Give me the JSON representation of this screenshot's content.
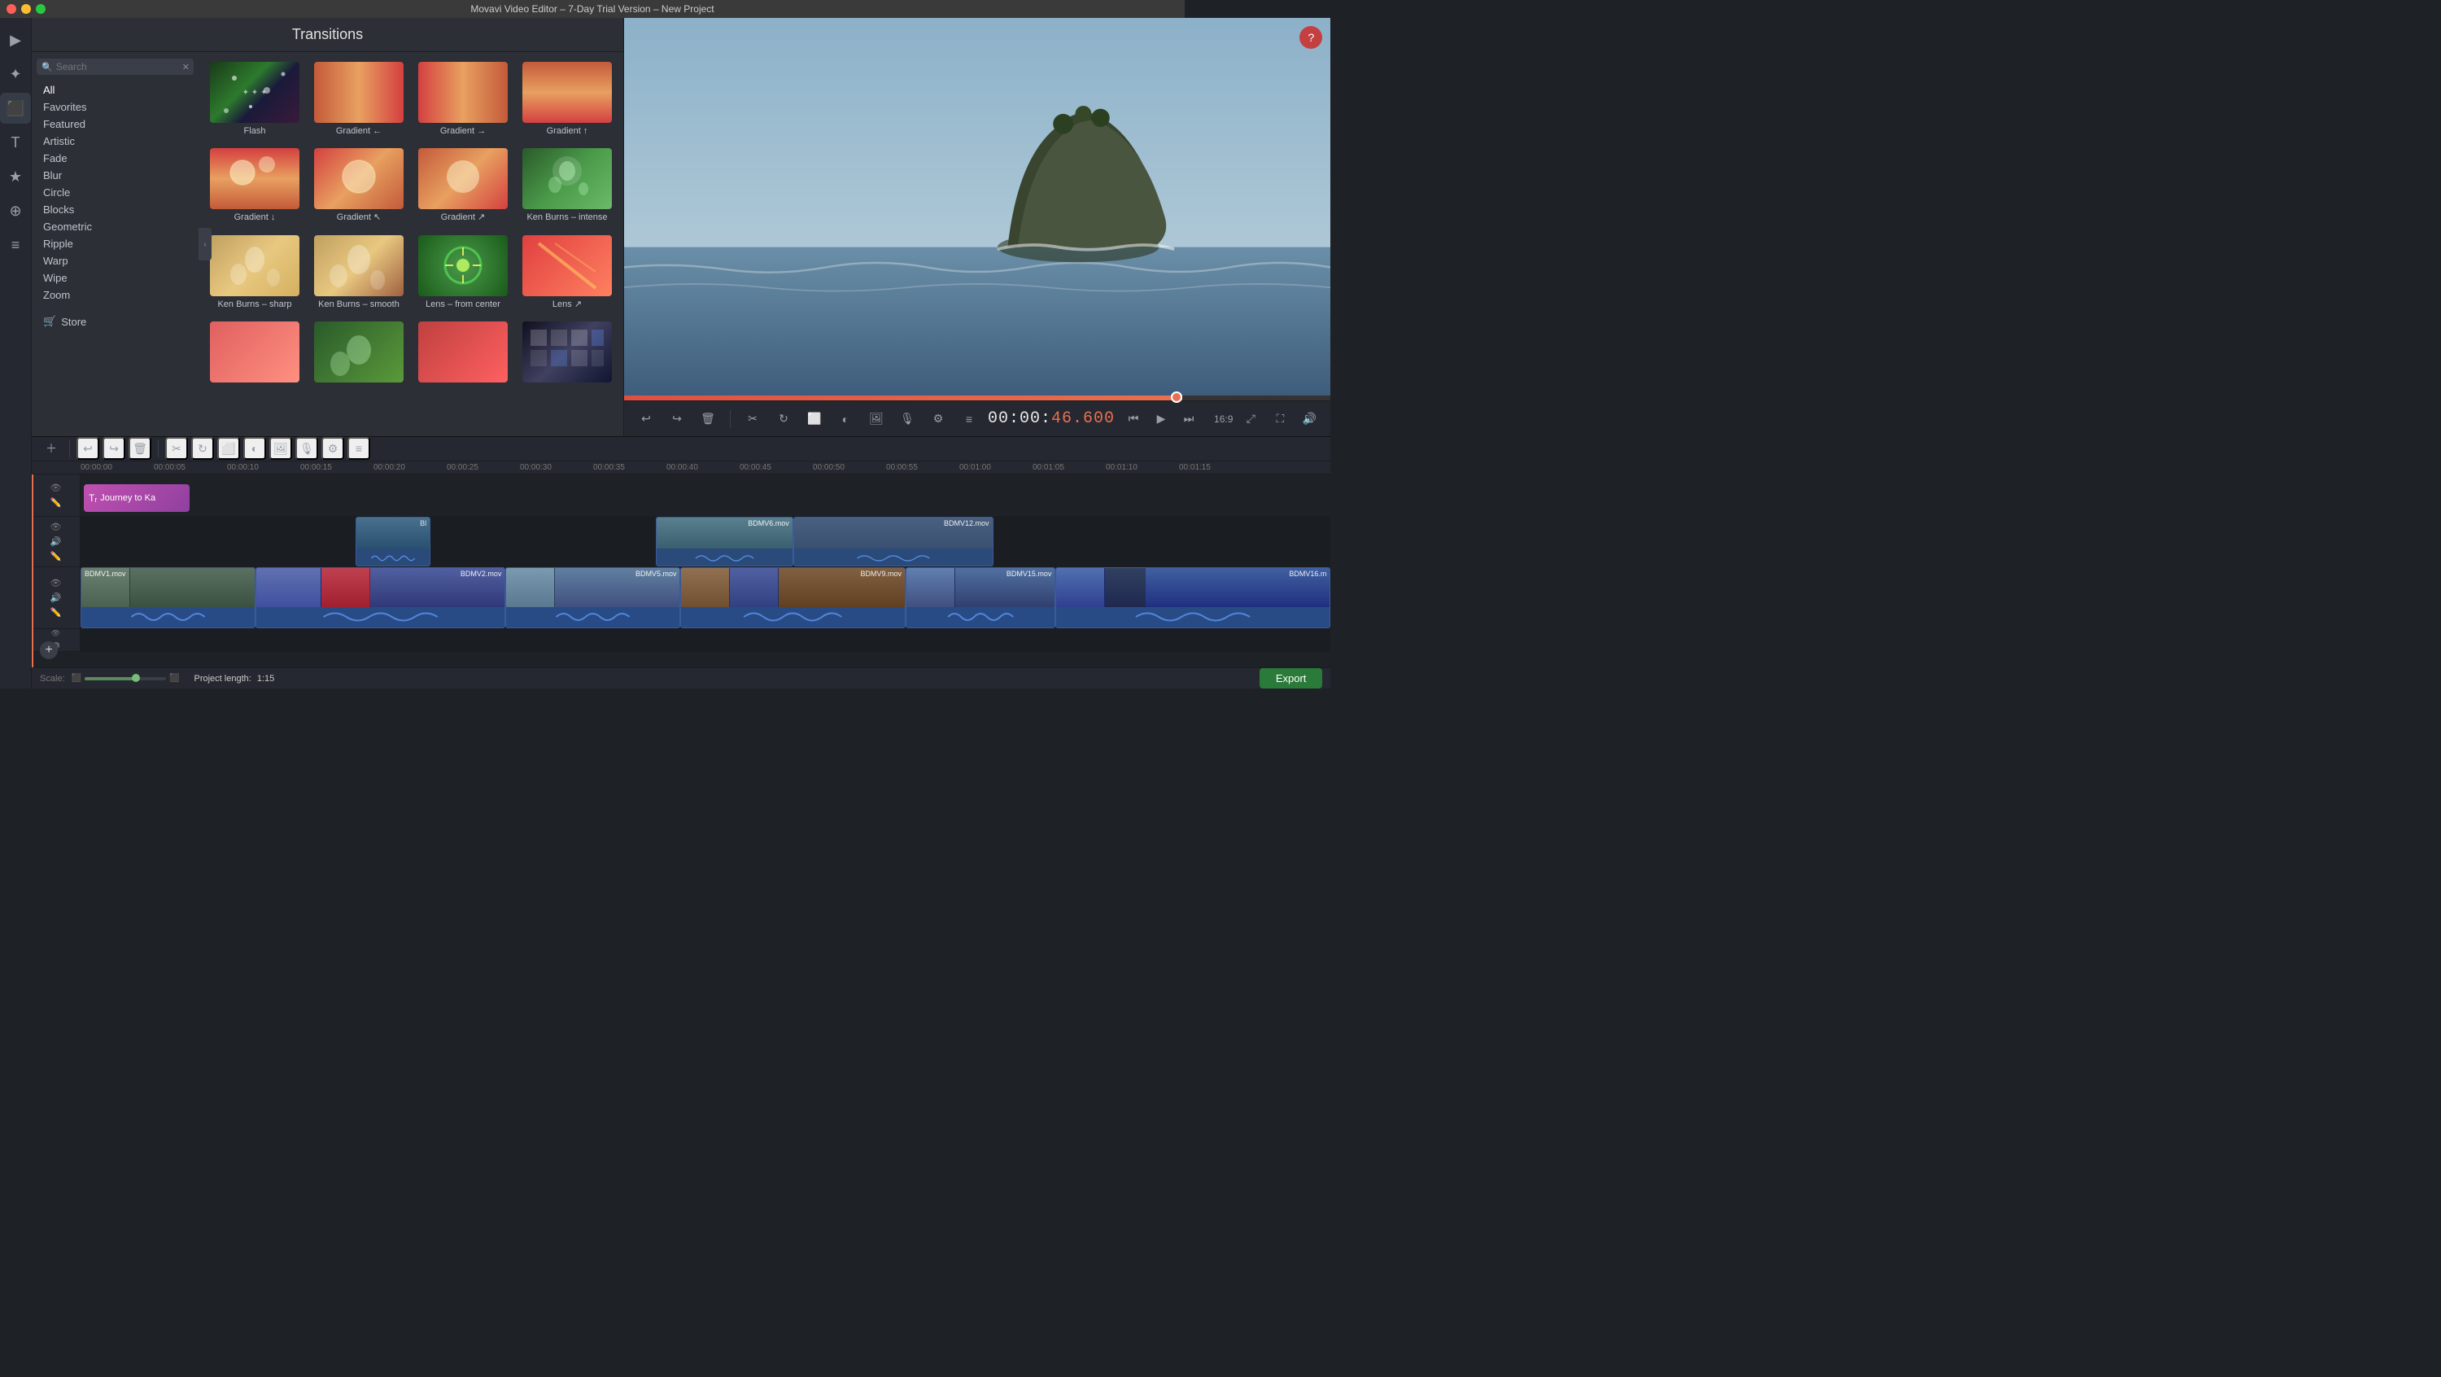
{
  "window": {
    "title": "Movavi Video Editor – 7-Day Trial Version – New Project"
  },
  "sidebar": {
    "icons": [
      {
        "name": "media-icon",
        "symbol": "▶",
        "active": false
      },
      {
        "name": "effects-icon",
        "symbol": "✦",
        "active": false
      },
      {
        "name": "clips-icon",
        "symbol": "⬛",
        "active": true
      },
      {
        "name": "text-icon",
        "symbol": "T",
        "active": false
      },
      {
        "name": "transitions-icon",
        "symbol": "★",
        "active": false
      },
      {
        "name": "filters-icon",
        "symbol": "⊕",
        "active": false
      },
      {
        "name": "audio-icon",
        "symbol": "≡",
        "active": false
      }
    ]
  },
  "transitions": {
    "title": "Transitions",
    "search_placeholder": "Search",
    "categories": [
      {
        "label": "All",
        "active": true
      },
      {
        "label": "Favorites",
        "active": false
      },
      {
        "label": "Featured",
        "active": false
      },
      {
        "label": "Artistic",
        "active": false
      },
      {
        "label": "Fade",
        "active": false
      },
      {
        "label": "Blur",
        "active": false
      },
      {
        "label": "Circle",
        "active": false
      },
      {
        "label": "Blocks",
        "active": false
      },
      {
        "label": "Geometric",
        "active": false
      },
      {
        "label": "Ripple",
        "active": false
      },
      {
        "label": "Warp",
        "active": false
      },
      {
        "label": "Wipe",
        "active": false
      },
      {
        "label": "Zoom",
        "active": false
      }
    ],
    "store_label": "Store",
    "items": [
      {
        "name": "Flash",
        "thumb": "flash"
      },
      {
        "name": "Gradient ←",
        "thumb": "gradient-l"
      },
      {
        "name": "Gradient →",
        "thumb": "gradient-r"
      },
      {
        "name": "Gradient ↑",
        "thumb": "gradient-u"
      },
      {
        "name": "Gradient ↓",
        "thumb": "gradient-d"
      },
      {
        "name": "Gradient ↖",
        "thumb": "gradient-br"
      },
      {
        "name": "Gradient ↗",
        "thumb": "gradient-tl"
      },
      {
        "name": "Ken Burns – intense",
        "thumb": "kburns-i"
      },
      {
        "name": "Ken Burns – sharp",
        "thumb": "kburns-sharp"
      },
      {
        "name": "Ken Burns – smooth",
        "thumb": "kburns-smooth"
      },
      {
        "name": "Lens – from center",
        "thumb": "lens-center"
      },
      {
        "name": "Lens ↗",
        "thumb": "lens-diag"
      },
      {
        "name": "",
        "thumb": "unknown1"
      },
      {
        "name": "",
        "thumb": "unknown2"
      },
      {
        "name": "",
        "thumb": "unknown3"
      },
      {
        "name": "",
        "thumb": "unknown4"
      }
    ]
  },
  "preview": {
    "question_label": "?",
    "timecode": "00:00:",
    "timecode_highlight": "46.600",
    "aspect_ratio": "16:9"
  },
  "toolbar": {
    "undo_label": "↩",
    "redo_label": "↪",
    "delete_label": "🗑",
    "cut_label": "✂",
    "rotate_label": "↻",
    "crop_label": "⬜",
    "color_label": "◐",
    "image_label": "🖼",
    "audio_label": "🎙",
    "settings_label": "⚙",
    "levels_label": "≡"
  },
  "timeline": {
    "time_markers": [
      "00:00:00",
      "00:00:05",
      "00:00:10",
      "00:00:15",
      "00:00:20",
      "00:00:25",
      "00:00:30",
      "00:00:35",
      "00:00:40",
      "00:00:45",
      "00:00:50",
      "00:00:55",
      "00:01:00",
      "00:01:05",
      "00:01:10",
      "00:01:15"
    ],
    "title_clip": "Journey to Ka",
    "clips_row1": [
      {
        "label": "Bl",
        "start_pct": 22,
        "width_pct": 6
      },
      {
        "label": "BDMV6.mov",
        "start_pct": 46,
        "width_pct": 11
      },
      {
        "label": "BDMV12.mov",
        "start_pct": 57,
        "width_pct": 16
      }
    ],
    "clips_main": [
      {
        "label": "BDMV1.mov",
        "start_pct": 0,
        "width_pct": 14
      },
      {
        "label": "BDMV2.mov",
        "start_pct": 14,
        "width_pct": 20
      },
      {
        "label": "BDMV5.mov",
        "start_pct": 34,
        "width_pct": 14
      },
      {
        "label": "BDMV9.mov",
        "start_pct": 48,
        "width_pct": 18
      },
      {
        "label": "BDMV15.mov",
        "start_pct": 66,
        "width_pct": 12
      },
      {
        "label": "BDMV16.m",
        "start_pct": 78,
        "width_pct": 22
      }
    ],
    "playhead_pct": 61,
    "add_track_label": "+"
  },
  "bottom_bar": {
    "scale_label": "Scale:",
    "project_length_label": "Project length:",
    "project_length_value": "1:15",
    "export_label": "Export"
  }
}
